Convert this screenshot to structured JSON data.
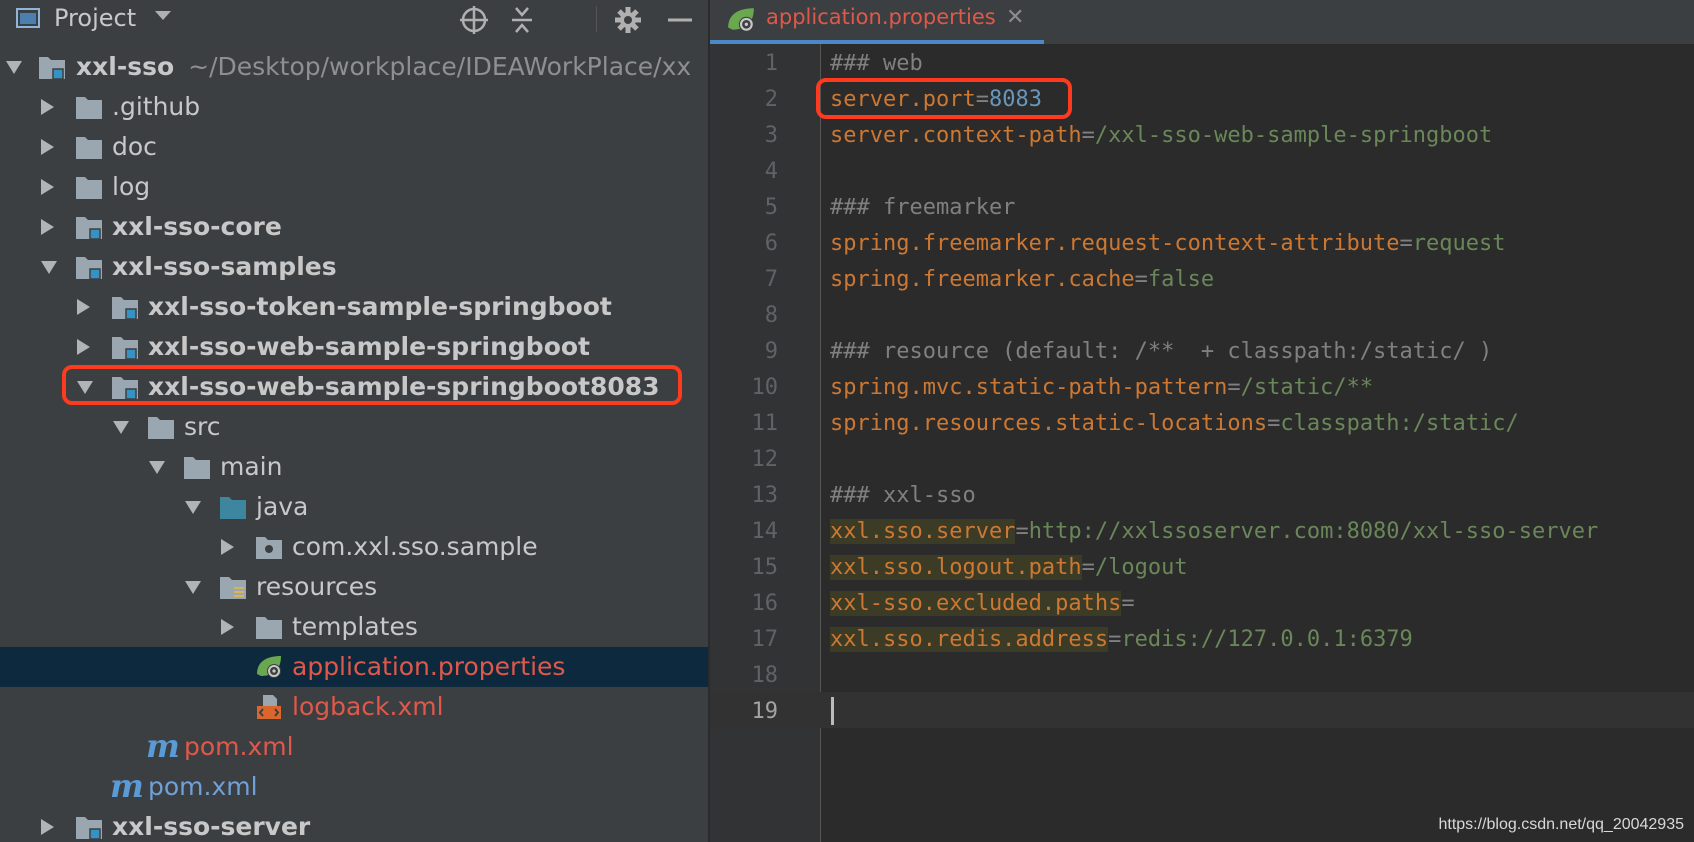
{
  "project_panel": {
    "title": "Project",
    "tree": [
      {
        "label": "xxl-sso",
        "path": "~/Desktop/workplace/IDEAWorkPlace/xx",
        "expanded": true
      },
      {
        "label": ".github"
      },
      {
        "label": "doc"
      },
      {
        "label": "log"
      },
      {
        "label": "xxl-sso-core"
      },
      {
        "label": "xxl-sso-samples",
        "expanded": true
      },
      {
        "label": "xxl-sso-token-sample-springboot"
      },
      {
        "label": "xxl-sso-web-sample-springboot"
      },
      {
        "label": "xxl-sso-web-sample-springboot8083",
        "expanded": true
      },
      {
        "label": "src",
        "expanded": true
      },
      {
        "label": "main",
        "expanded": true
      },
      {
        "label": "java",
        "expanded": true
      },
      {
        "label": "com.xxl.sso.sample"
      },
      {
        "label": "resources",
        "expanded": true
      },
      {
        "label": "templates"
      },
      {
        "label": "application.properties",
        "selected": true
      },
      {
        "label": "logback.xml"
      },
      {
        "label": "pom.xml"
      },
      {
        "label": "pom.xml"
      },
      {
        "label": "xxl-sso-server"
      }
    ]
  },
  "editor": {
    "tab_label": "application.properties",
    "lines": [
      {
        "num": "1",
        "comment": "### web"
      },
      {
        "num": "2",
        "key": "server.port",
        "value": "8083"
      },
      {
        "num": "3",
        "key": "server.context-path",
        "value": "/xxl-sso-web-sample-springboot"
      },
      {
        "num": "4"
      },
      {
        "num": "5",
        "comment": "### freemarker"
      },
      {
        "num": "6",
        "key": "spring.freemarker.request-context-attribute",
        "value": "request"
      },
      {
        "num": "7",
        "key": "spring.freemarker.cache",
        "value": "false"
      },
      {
        "num": "8"
      },
      {
        "num": "9",
        "comment": "### resource (default: /**  + classpath:/static/ )"
      },
      {
        "num": "10",
        "key": "spring.mvc.static-path-pattern",
        "value": "/static/**"
      },
      {
        "num": "11",
        "key": "spring.resources.static-locations",
        "value": "classpath:/static/"
      },
      {
        "num": "12"
      },
      {
        "num": "13",
        "comment": "### xxl-sso"
      },
      {
        "num": "14",
        "key": "xxl.sso.server",
        "value": "http://xxlssoserver.com:8080/xxl-sso-server"
      },
      {
        "num": "15",
        "key": "xxl.sso.logout.path",
        "value": "/logout"
      },
      {
        "num": "16",
        "key": "xxl-sso.excluded.paths",
        "value": ""
      },
      {
        "num": "17",
        "key": "xxl.sso.redis.address",
        "value": "redis://127.0.0.1:6379"
      },
      {
        "num": "18"
      },
      {
        "num": "19"
      }
    ]
  },
  "watermark": "https://blog.csdn.net/qq_20042935",
  "colors": {
    "highlight_box": "#ff3b1f",
    "modified_file": "#e0584a",
    "selection": "#0d293e"
  }
}
